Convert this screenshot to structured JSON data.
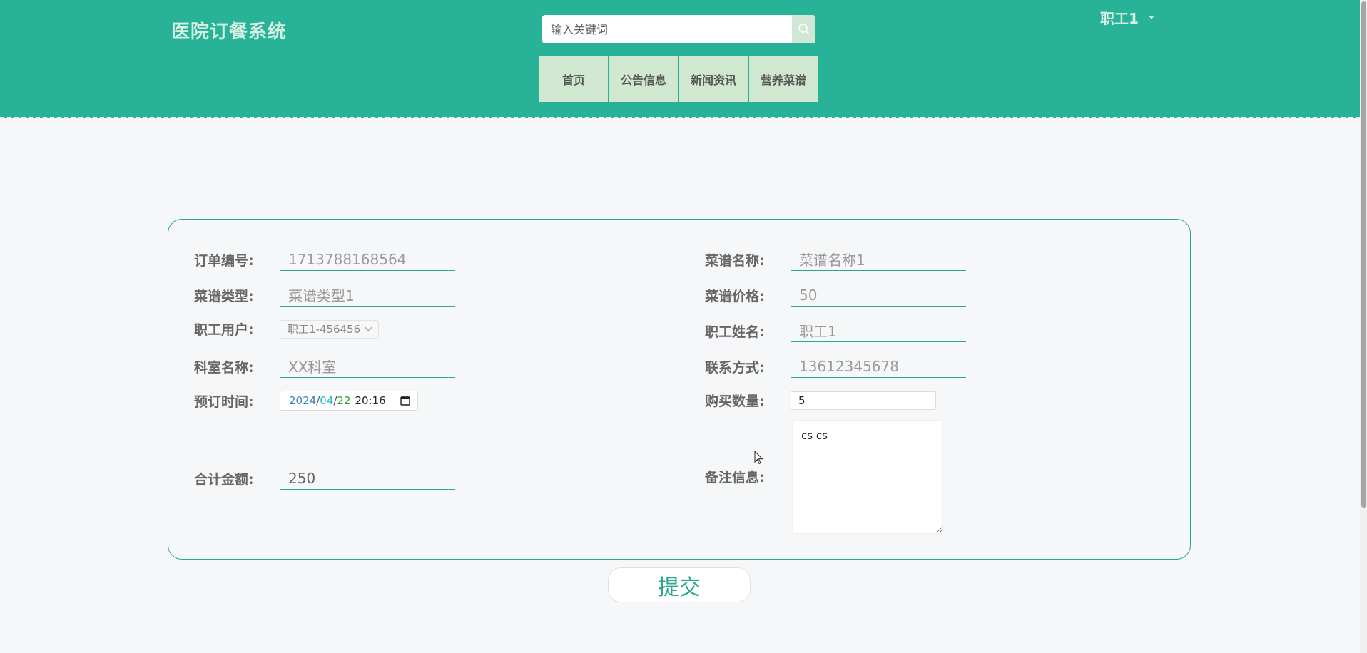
{
  "header": {
    "site_title": "医院订餐系统",
    "search_placeholder": "输入关键词",
    "nav": [
      "首页",
      "公告信息",
      "新闻资讯",
      "营养菜谱"
    ],
    "user_name": "职工1"
  },
  "form": {
    "order_no": {
      "label": "订单编号:",
      "value": "1713788168564"
    },
    "menu_name": {
      "label": "菜谱名称:",
      "value": "菜谱名称1"
    },
    "menu_type": {
      "label": "菜谱类型:",
      "value": "菜谱类型1"
    },
    "menu_price": {
      "label": "菜谱价格:",
      "value": "50"
    },
    "staff_user": {
      "label": "职工用户:",
      "value": "职工1-456456"
    },
    "staff_name": {
      "label": "职工姓名:",
      "value": "职工1"
    },
    "dept_name": {
      "label": "科室名称:",
      "value": "XX科室"
    },
    "contact": {
      "label": "联系方式:",
      "value": "13612345678"
    },
    "order_time": {
      "label": "预订时间:",
      "year": "2024",
      "month": "04",
      "day": "22",
      "time": "20:16",
      "sep": "/"
    },
    "quantity": {
      "label": "购买数量:",
      "value": "5"
    },
    "total": {
      "label": "合计金额:",
      "value": "250"
    },
    "remark": {
      "label": "备注信息:",
      "value": "cs cs "
    }
  },
  "submit_label": "提交",
  "colors": {
    "header_bg": "#28b399",
    "nav_bg": "#d1e8d0",
    "accent": "#2aa88e",
    "page_bg": "#f6f7f8"
  },
  "icons": {
    "search": "search-icon",
    "caret": "caret-down-icon",
    "calendar": "calendar-icon",
    "chevron": "chevron-down-icon"
  }
}
